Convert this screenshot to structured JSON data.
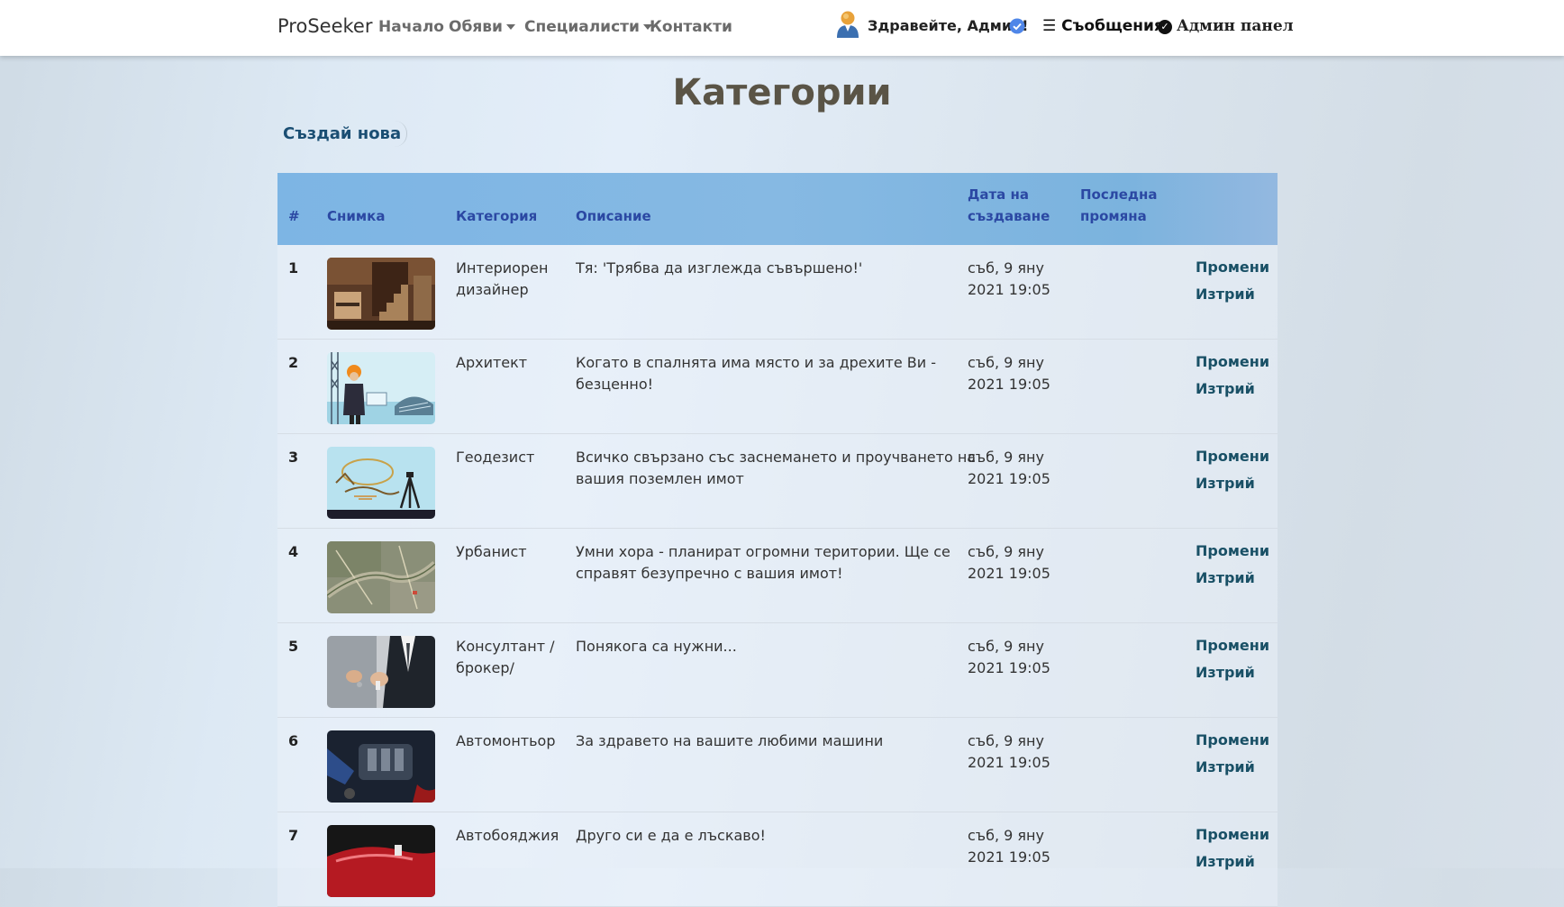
{
  "navbar": {
    "brand": "ProSeeker",
    "links": [
      "Начало",
      "Обяви",
      "Специалисти",
      "Контакти"
    ],
    "greeting": "Здравейте, Админ!",
    "messages": "☰ Съобщения",
    "admin_panel": "Админ панел"
  },
  "page": {
    "title": "Категории",
    "create_button": "Създай нова"
  },
  "table": {
    "headers": {
      "num": "#",
      "image": "Снимка",
      "category": "Категория",
      "description": "Описание",
      "created_1": "Дата на",
      "created_2": "създаване",
      "modified_1": "Последна",
      "modified_2": "промяна"
    },
    "rows": [
      {
        "num": "1",
        "category_1": "Интериорен",
        "category_2": "дизайнер",
        "desc_1": "Тя: 'Трябва да изглежда съвършено!'",
        "desc_2": "",
        "date_1": "съб, 9 яну",
        "date_2": "2021 19:05",
        "edit": "Промени",
        "delete": "Изтрий",
        "thumb": "interior-photo"
      },
      {
        "num": "2",
        "category_1": "Архитект",
        "category_2": "",
        "desc_1": "Когато в спалнята има място и за дрехите Ви -",
        "desc_2": "безценно!",
        "date_1": "съб, 9 яну",
        "date_2": "2021 19:05",
        "edit": "Промени",
        "delete": "Изтрий",
        "thumb": "architect-illustration"
      },
      {
        "num": "3",
        "category_1": "Геодезист",
        "category_2": "",
        "desc_1": "Всичко свързано със заснемането и проучването на",
        "desc_2": "вашия поземлен имот",
        "date_1": "съб, 9 яну",
        "date_2": "2021 19:05",
        "edit": "Промени",
        "delete": "Изтрий",
        "thumb": "geodesy-illustration"
      },
      {
        "num": "4",
        "category_1": "Урбанист",
        "category_2": "",
        "desc_1": "Умни хора - планират огромни територии. Ще се",
        "desc_2": "справят безупречно с вашия имот!",
        "date_1": "съб, 9 яну",
        "date_2": "2021 19:05",
        "edit": "Промени",
        "delete": "Изтрий",
        "thumb": "map-photo"
      },
      {
        "num": "5",
        "category_1": "Консултант /",
        "category_2": "брокер/",
        "desc_1": "Понякога са нужни...",
        "desc_2": "",
        "date_1": "съб, 9 яну",
        "date_2": "2021 19:05",
        "edit": "Промени",
        "delete": "Изтрий",
        "thumb": "keys-handover-photo"
      },
      {
        "num": "6",
        "category_1": "Автомонтьор",
        "category_2": "",
        "desc_1": "За здравето на вашите любими машини",
        "desc_2": "",
        "date_1": "съб, 9 яну",
        "date_2": "2021 19:05",
        "edit": "Промени",
        "delete": "Изтрий",
        "thumb": "engine-photo"
      },
      {
        "num": "7",
        "category_1": "Автобояджия",
        "category_2": "",
        "desc_1": "Друго си е да е лъскаво!",
        "desc_2": "",
        "date_1": "съб, 9 яну",
        "date_2": "2021 19:05",
        "edit": "Промени",
        "delete": "Изтрий",
        "thumb": "car-paint-photo"
      }
    ]
  },
  "colors": {
    "header_bg": "#86b9e3",
    "header_text": "#2b48a3",
    "action_text": "#195066",
    "title_text": "#5a5446"
  }
}
